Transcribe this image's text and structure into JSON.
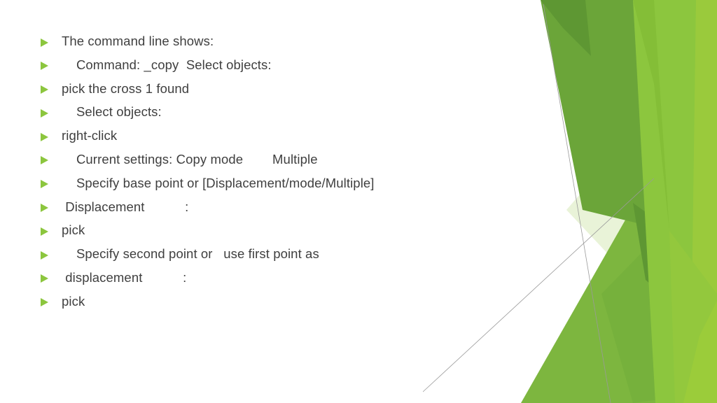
{
  "slide": {
    "background_color": "#FFFFFF",
    "text_color": "#3F3F3F",
    "bullet_color": "#8CC63E"
  },
  "decoration": {
    "name": "facet-green-polygons",
    "colors": {
      "dark_green": "#6BA539",
      "mid_green": "#7DB63F",
      "bright_green": "#8CC63E",
      "yellow_green": "#9ACA3C",
      "light_green": "#C5E0A0",
      "pale_green": "#E3F0CE",
      "very_pale_green": "#EFF6E2",
      "hairline": "#9A9A9A"
    }
  },
  "content": {
    "bullets": [
      {
        "text": "The command line shows:"
      },
      {
        "text": "    Command: _copy  Select objects:"
      },
      {
        "text": "pick the cross 1 found"
      },
      {
        "text": "    Select objects:"
      },
      {
        "text": "right-click"
      },
      {
        "text": "    Current settings: Copy mode        Multiple"
      },
      {
        "text": "    Specify base point or [Displacement/mode/Multiple]"
      },
      {
        "text": " Displacement           :"
      },
      {
        "text": "pick"
      },
      {
        "text": "    Specify second point or   use first point as"
      },
      {
        "text": " displacement           :"
      },
      {
        "text": "pick"
      }
    ]
  }
}
